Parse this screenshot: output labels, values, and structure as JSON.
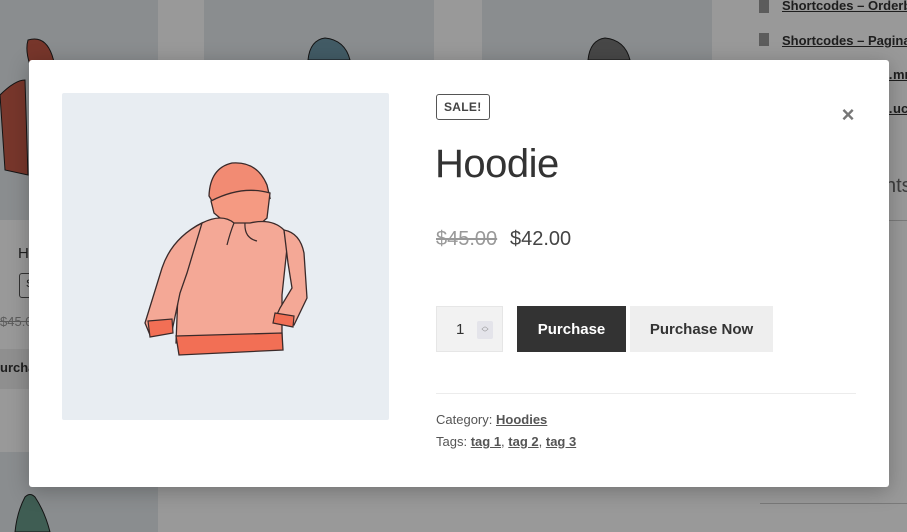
{
  "background": {
    "sidebar_links": [
      "Shortcodes – Orderby",
      "Shortcodes – Paginat",
      "…mm",
      "…ucts"
    ],
    "sidebar_heading_fragment": "nts",
    "product_card": {
      "title_fragment": "H",
      "badge_fragment": "S",
      "price_fragment": "$45.0",
      "button_fragment": "urcha"
    }
  },
  "modal": {
    "badge": "SALE!",
    "close_icon": "×",
    "title": "Hoodie",
    "price": {
      "regular": "$45.00",
      "sale": "$42.00"
    },
    "quantity": {
      "value": "1"
    },
    "buttons": {
      "purchase": "Purchase",
      "purchase_now": "Purchase Now"
    },
    "meta": {
      "category_label": "Category:",
      "category": "Hoodies",
      "tags_label": "Tags:",
      "tags": [
        "tag 1",
        "tag 2",
        "tag 3"
      ]
    },
    "image": {
      "description": "hoodie-illustration",
      "color": "#f28b73"
    }
  }
}
